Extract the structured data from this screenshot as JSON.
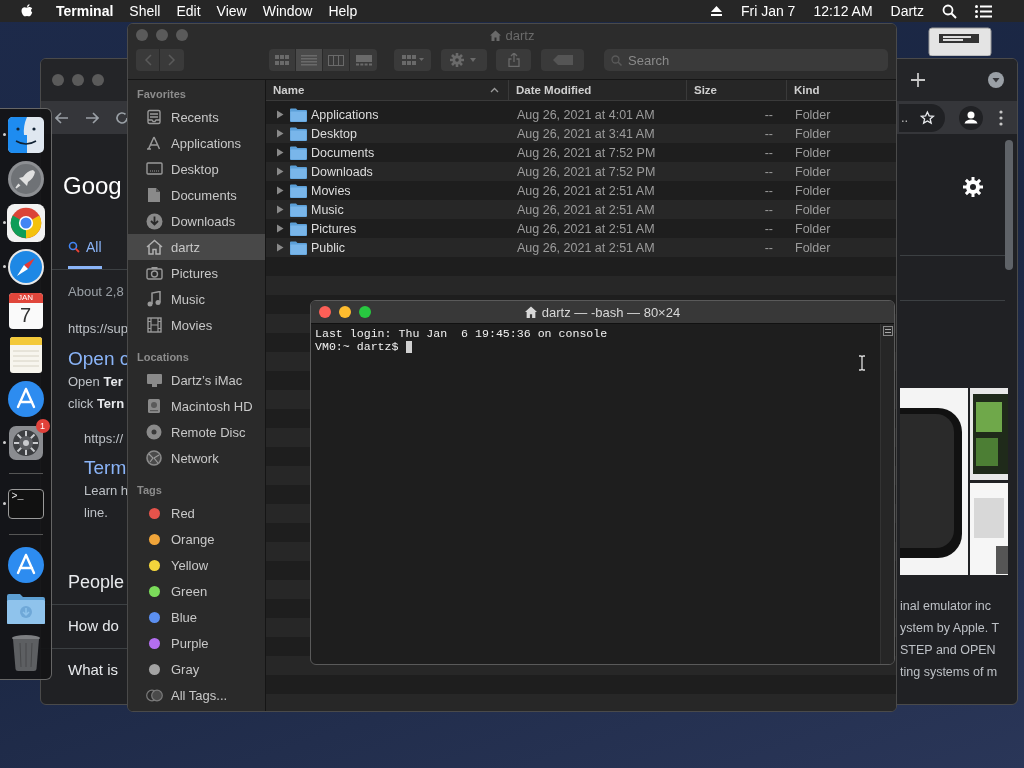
{
  "menu_bar": {
    "app": "Terminal",
    "menus": [
      "Shell",
      "Edit",
      "View",
      "Window",
      "Help"
    ],
    "date": "Fri Jan 7",
    "time": "12:12 AM",
    "user": "Dartz"
  },
  "dock": {
    "items": [
      {
        "kind": "finder",
        "running": true
      },
      {
        "kind": "launchpad",
        "running": false
      },
      {
        "kind": "chrome",
        "running": true
      },
      {
        "kind": "safari",
        "running": true
      },
      {
        "kind": "calendar",
        "running": false,
        "month": "JAN",
        "day": "7"
      },
      {
        "kind": "notes",
        "running": false
      },
      {
        "kind": "appstore",
        "running": false
      },
      {
        "kind": "preferences",
        "running": true,
        "badge": "1"
      },
      {
        "kind": "separator"
      },
      {
        "kind": "terminal",
        "running": true,
        "glyph": ">_"
      },
      {
        "kind": "separator"
      },
      {
        "kind": "appstore",
        "running": false
      },
      {
        "kind": "folder",
        "running": false
      },
      {
        "kind": "trash",
        "running": false
      }
    ]
  },
  "browser": {
    "logo": "Goog",
    "tab": {
      "label": "All",
      "selected": true
    },
    "result_count": "About 2,8",
    "results": [
      {
        "url": "https://sup",
        "title": "Open c",
        "snippet": [
          "Open **Ter**",
          "click **Tern**"
        ],
        "indented": false
      },
      {
        "url": "https://",
        "title": "Term",
        "snippet": [
          "Learn h",
          "line."
        ],
        "indented": true
      }
    ],
    "heading": "People",
    "questions": [
      "How do",
      "What is"
    ],
    "address_tail": "..",
    "snippet_right": [
      "inal emulator inc",
      "ystem by Apple. T",
      "STEP and OPEN",
      "ting systems of m"
    ]
  },
  "finder": {
    "title": "dartz",
    "view_modes": [
      {
        "kind": "icons",
        "selected": false
      },
      {
        "kind": "list",
        "selected": true
      },
      {
        "kind": "columns",
        "selected": false
      },
      {
        "kind": "gallery",
        "selected": false
      }
    ],
    "search_placeholder": "Search",
    "sidebar": [
      {
        "heading": "Favorites",
        "items": [
          {
            "kind": "recents",
            "label": "Recents",
            "selected": false
          },
          {
            "kind": "applications",
            "label": "Applications",
            "selected": false
          },
          {
            "kind": "desktop",
            "label": "Desktop",
            "selected": false
          },
          {
            "kind": "documents",
            "label": "Documents",
            "selected": false
          },
          {
            "kind": "downloads",
            "label": "Downloads",
            "selected": false
          },
          {
            "kind": "home",
            "label": "dartz",
            "selected": true
          },
          {
            "kind": "pictures",
            "label": "Pictures",
            "selected": false
          },
          {
            "kind": "music",
            "label": "Music",
            "selected": false
          },
          {
            "kind": "movies",
            "label": "Movies",
            "selected": false
          }
        ]
      },
      {
        "heading": "Locations",
        "items": [
          {
            "kind": "computer",
            "label": "Dartz’s iMac",
            "selected": false
          },
          {
            "kind": "drive",
            "label": "Macintosh HD",
            "selected": false
          },
          {
            "kind": "disc",
            "label": "Remote Disc",
            "selected": false
          },
          {
            "kind": "network",
            "label": "Network",
            "selected": false
          }
        ]
      },
      {
        "heading": "Tags",
        "items": [
          {
            "kind": "tag",
            "label": "Red",
            "color": "#e5534b",
            "selected": false
          },
          {
            "kind": "tag",
            "label": "Orange",
            "color": "#f0a53a",
            "selected": false
          },
          {
            "kind": "tag",
            "label": "Yellow",
            "color": "#f3d53c",
            "selected": false
          },
          {
            "kind": "tag",
            "label": "Green",
            "color": "#7bdc5a",
            "selected": false
          },
          {
            "kind": "tag",
            "label": "Blue",
            "color": "#5b8ff0",
            "selected": false
          },
          {
            "kind": "tag",
            "label": "Purple",
            "color": "#b46ef0",
            "selected": false
          },
          {
            "kind": "tag",
            "label": "Gray",
            "color": "#a3a3a3",
            "selected": false
          },
          {
            "kind": "all-tags",
            "label": "All Tags...",
            "selected": false
          }
        ]
      }
    ],
    "columns": [
      {
        "label": "Name",
        "sorted": true
      },
      {
        "label": "Date Modified",
        "sorted": false
      },
      {
        "label": "Size",
        "sorted": false
      },
      {
        "label": "Kind",
        "sorted": false
      }
    ],
    "rows": [
      {
        "name": "Applications",
        "date": "Aug 26, 2021 at 4:01 AM",
        "size": "--",
        "kind": "Folder"
      },
      {
        "name": "Desktop",
        "date": "Aug 26, 2021 at 3:41 AM",
        "size": "--",
        "kind": "Folder"
      },
      {
        "name": "Documents",
        "date": "Aug 26, 2021 at 7:52 PM",
        "size": "--",
        "kind": "Folder"
      },
      {
        "name": "Downloads",
        "date": "Aug 26, 2021 at 7:52 PM",
        "size": "--",
        "kind": "Folder"
      },
      {
        "name": "Movies",
        "date": "Aug 26, 2021 at 2:51 AM",
        "size": "--",
        "kind": "Folder"
      },
      {
        "name": "Music",
        "date": "Aug 26, 2021 at 2:51 AM",
        "size": "--",
        "kind": "Folder"
      },
      {
        "name": "Pictures",
        "date": "Aug 26, 2021 at 2:51 AM",
        "size": "--",
        "kind": "Folder"
      },
      {
        "name": "Public",
        "date": "Aug 26, 2021 at 2:51 AM",
        "size": "--",
        "kind": "Folder"
      }
    ]
  },
  "terminal": {
    "title": "dartz — -bash — 80×24",
    "lines": [
      "Last login: Thu Jan  6 19:45:36 on console",
      "VM0:~ dartz$"
    ]
  }
}
